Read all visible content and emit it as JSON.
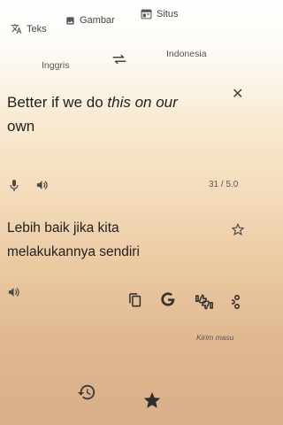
{
  "tabs": [
    {
      "label": "Teks",
      "icon": "translate-icon"
    },
    {
      "label": "Gambar",
      "icon": "image-icon"
    },
    {
      "label": "Situs",
      "icon": "website-icon"
    }
  ],
  "languages": {
    "source": "Inggris",
    "target": "Indonesia",
    "swap_icon": "swap-icon"
  },
  "source": {
    "text_part1": "Better if we do ",
    "text_part2": "this on our",
    "text_part3": "own",
    "char_count": "31 / 5.0"
  },
  "translation": {
    "text_line1": "Lebih baik jika kita",
    "text_line2": "melakukannya sendiri"
  },
  "feedback_label": "Kirim masu",
  "bottom_nav": [
    "history-icon",
    "star-icon"
  ]
}
